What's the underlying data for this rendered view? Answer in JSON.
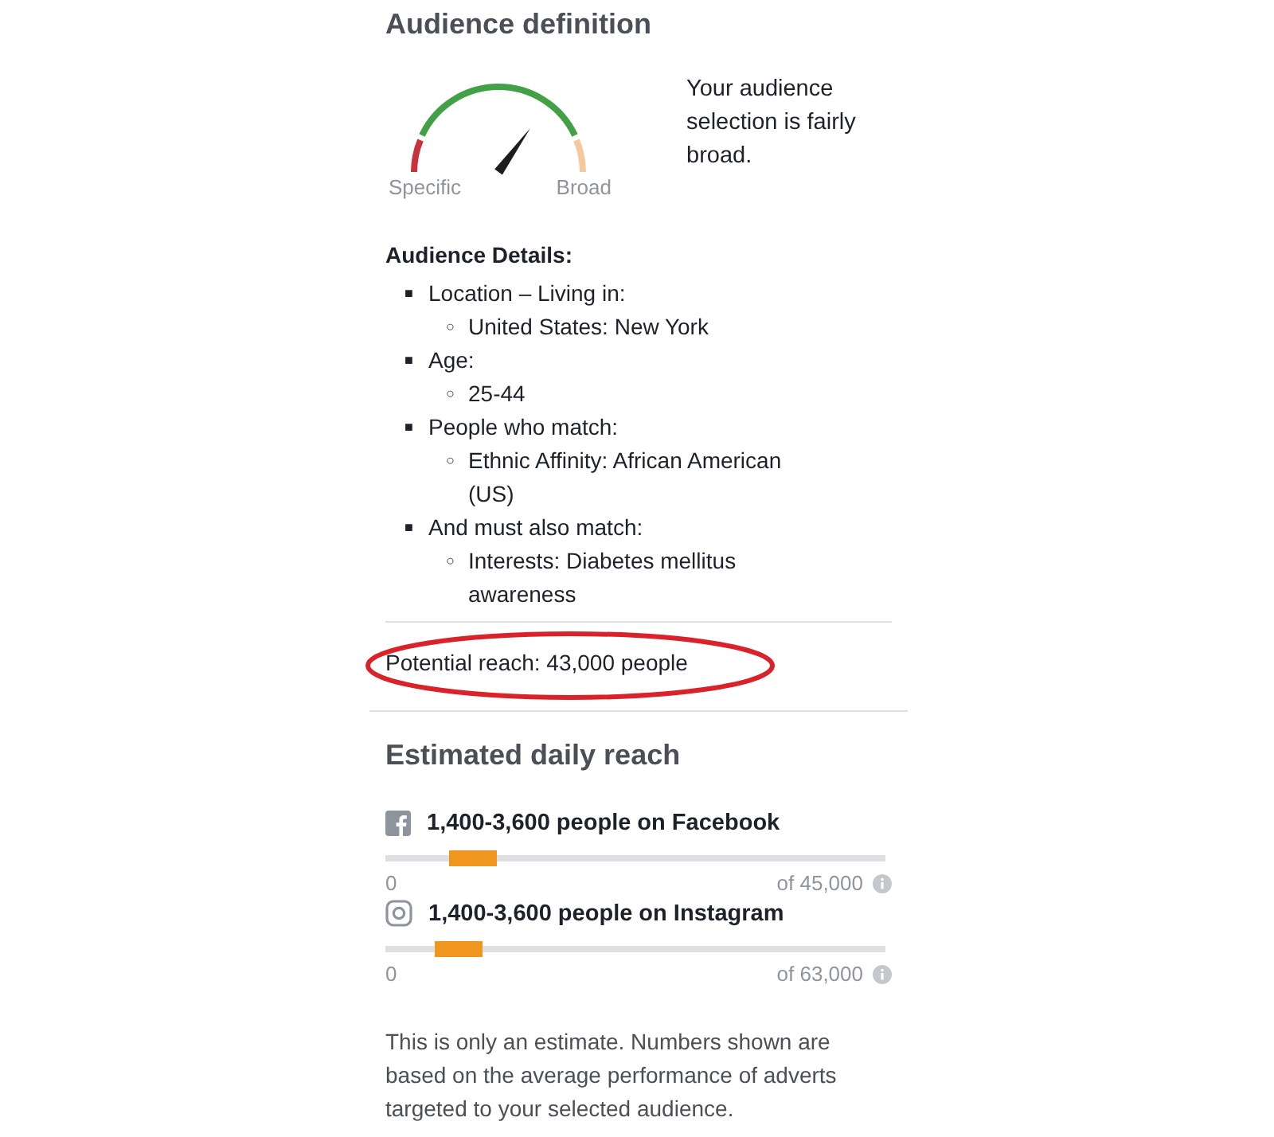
{
  "audience_definition": {
    "title": "Audience definition",
    "gauge": {
      "low_label": "Specific",
      "high_label": "Broad"
    },
    "summary": "Your audience selection is fairly broad."
  },
  "audience_details": {
    "title": "Audience Details:",
    "items": [
      {
        "marker": "■",
        "label": "Location – Living in:",
        "children": [
          {
            "marker": "○",
            "label": "United States: New York"
          }
        ]
      },
      {
        "marker": "■",
        "label": "Age:",
        "children": [
          {
            "marker": "○",
            "label": "25-44"
          }
        ]
      },
      {
        "marker": "■",
        "label": "People who match:",
        "children": [
          {
            "marker": "○",
            "label": "Ethnic Affinity: African American (US)"
          }
        ]
      },
      {
        "marker": "■",
        "label": "And must also match:",
        "children": [
          {
            "marker": "○",
            "label": "Interests: Diabetes mellitus awareness"
          }
        ]
      }
    ]
  },
  "potential_reach": {
    "text": "Potential reach: 43,000 people",
    "highlighted": true
  },
  "estimated_daily_reach": {
    "title": "Estimated daily reach",
    "platforms": [
      {
        "kind": "facebook",
        "label": "1,400-3,600 people on Facebook",
        "level": 0.175,
        "min": "0",
        "max": "of 45,000"
      },
      {
        "kind": "instagram",
        "label": "1,400-3,600 people on Instagram",
        "level": 0.145,
        "min": "0",
        "max": "of 63,000"
      }
    ],
    "note": "This is only an estimate. Numbers shown are based on the average performance of adverts targeted to your selected audience."
  }
}
